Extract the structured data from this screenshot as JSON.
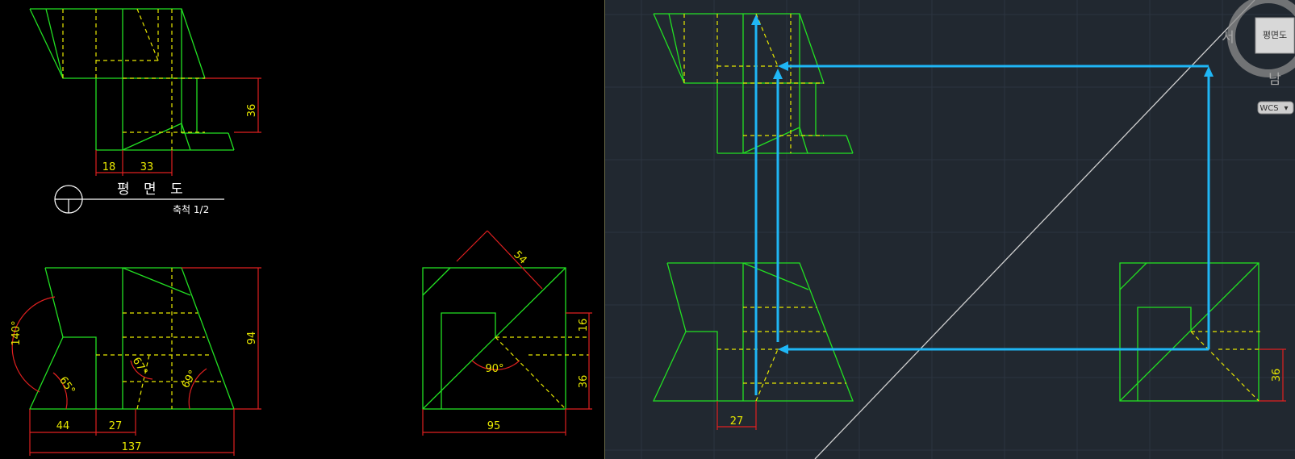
{
  "left_drawing": {
    "plan_title": "평 면 도",
    "plan_scale": "축척 1/2",
    "dims_plan": {
      "height": "36",
      "w1": "18",
      "w2": "33"
    },
    "dims_front": {
      "angle_left": "140°",
      "angle_a": "65°",
      "angle_b": "67°",
      "angle_c": "69°",
      "height": "94",
      "w_left": "44",
      "w_mid": "27",
      "w_total": "137"
    },
    "dims_side": {
      "diag": "54",
      "angle": "90°",
      "h1": "16",
      "h2": "36",
      "width": "95"
    }
  },
  "right_drawing": {
    "dim_bottom": "27",
    "dim_right": "36"
  },
  "viewcube": {
    "face_label": "평면도",
    "west": "서",
    "south": "남",
    "wcs": "WCS"
  }
}
